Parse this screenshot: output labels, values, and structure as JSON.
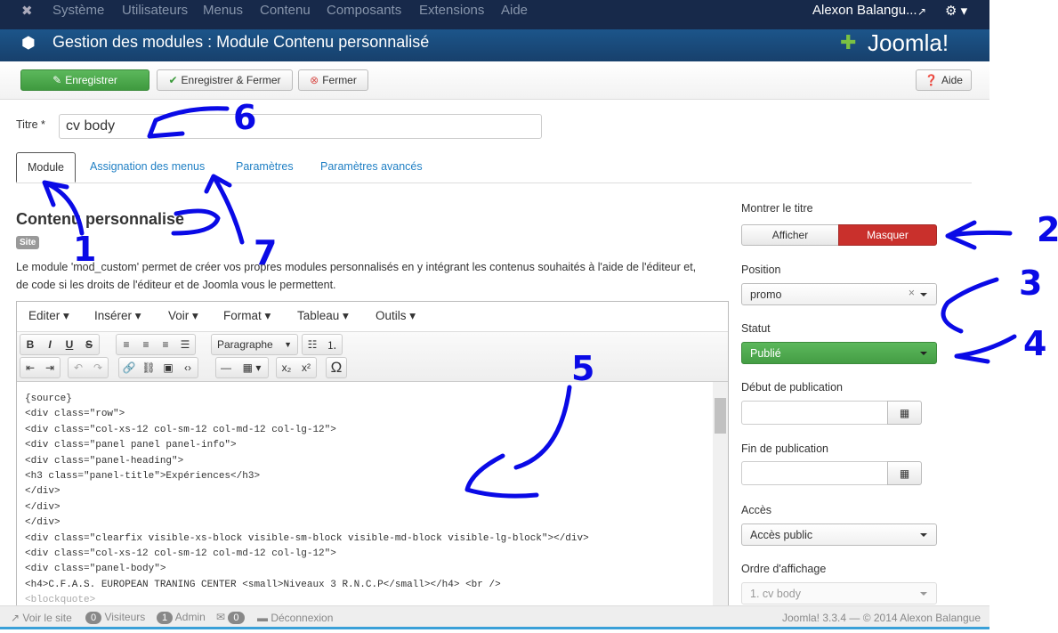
{
  "nav": {
    "items": [
      "Système",
      "Utilisateurs",
      "Menus",
      "Contenu",
      "Composants",
      "Extensions",
      "Aide"
    ],
    "user": "Alexon Balangu...",
    "brand": "Joomla!"
  },
  "header": {
    "title": "Gestion des modules : Module Contenu personnalisé"
  },
  "toolbar": {
    "save": "Enregistrer",
    "save_close": "Enregistrer & Fermer",
    "close": "Fermer",
    "help": "Aide"
  },
  "form": {
    "title_label": "Titre *",
    "title_value": "cv body"
  },
  "tabs": [
    "Module",
    "Assignation des menus",
    "Paramètres",
    "Paramètres avancés"
  ],
  "module": {
    "heading": "Contenu personnalisé",
    "badge": "Site",
    "desc1": "Le module 'mod_custom' permet de créer vos propres modules personnalisés en y intégrant les contenus souhaités à l'aide de l'éditeur et,",
    "desc2": "de code si les droits de l'éditeur et de Joomla vous le permettent."
  },
  "editor": {
    "menus": [
      "Editer",
      "Insérer",
      "Voir",
      "Format",
      "Tableau",
      "Outils"
    ],
    "format_select": "Paragraphe",
    "lines": [
      "{source}",
      "<div class=\"row\">",
      "<div class=\"col-xs-12 col-sm-12 col-md-12 col-lg-12\">",
      "<div class=\"panel panel panel-info\">",
      "<div class=\"panel-heading\">",
      "<h3 class=\"panel-title\">Expériences</h3>",
      "</div>",
      "</div>",
      "</div>",
      "<div class=\"clearfix visible-xs-block visible-sm-block visible-md-block visible-lg-block\"></div>",
      "<div class=\"col-xs-12 col-sm-12 col-md-12 col-lg-12\">",
      "<div class=\"panel-body\">",
      "<h4>C.F.A.S. EUROPEAN TRANING CENTER <small>Niveaux 3 R.N.C.P</small></h4> <br />",
      "<blockquote>"
    ]
  },
  "side": {
    "show_title_label": "Montrer le titre",
    "show": "Afficher",
    "hide": "Masquer",
    "position_label": "Position",
    "position": "promo",
    "status_label": "Statut",
    "status": "Publié",
    "start_label": "Début de publication",
    "end_label": "Fin de publication",
    "access_label": "Accès",
    "access": "Accès public",
    "order_label": "Ordre d'affichage",
    "order": "1. cv body"
  },
  "footer": {
    "view_site": "Voir le site",
    "visitors_count": "0",
    "visitors": "Visiteurs",
    "admin_count": "1",
    "admin": "Admin",
    "messages_count": "0",
    "logout": "Déconnexion",
    "version": "Joomla! 3.3.4 — © 2014 Alexon Balangue"
  },
  "annotations": [
    "1",
    "2",
    "3",
    "4",
    "5",
    "6",
    "7"
  ],
  "colors": {
    "nav": "#17294a",
    "header": "#1c558a",
    "green": "#4cae4c",
    "red": "#c9302c",
    "link": "#1f7fc4",
    "annotation": "#0a0ae6"
  }
}
